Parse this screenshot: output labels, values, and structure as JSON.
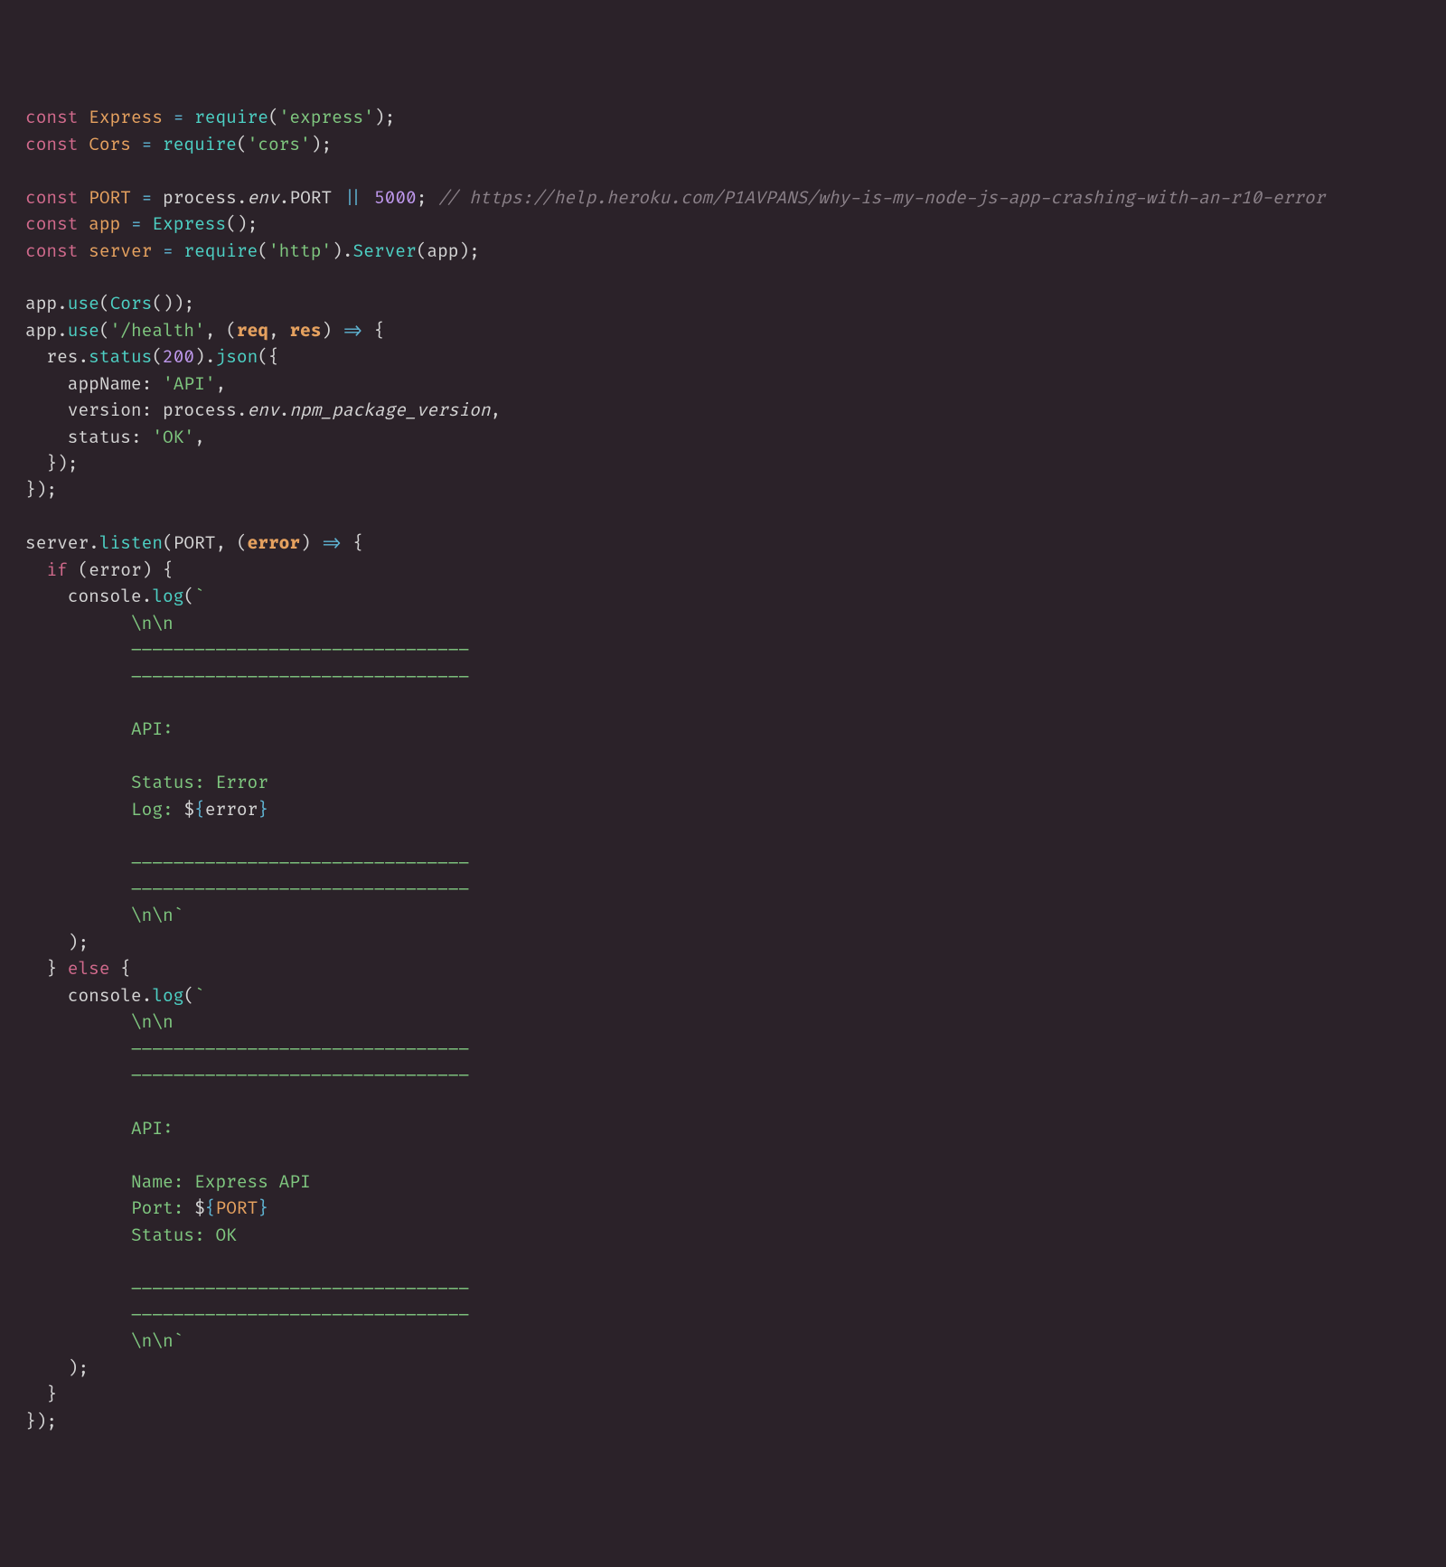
{
  "code": {
    "l1": {
      "kw": "const",
      "name": "Express",
      "eq": " = ",
      "fn": "require",
      "op1": "(",
      "str": "'express'",
      "op2": ")",
      "end": ";"
    },
    "l2": {
      "kw": "const",
      "name": "Cors",
      "eq": " = ",
      "fn": "require",
      "op1": "(",
      "str": "'cors'",
      "op2": ")",
      "end": ";"
    },
    "l4": {
      "kw": "const",
      "name": "PORT",
      "eq": " = ",
      "obj": "process",
      "dot1": ".",
      "env": "env",
      "dot2": ".",
      "prop": "PORT",
      "or": " || ",
      "num": "5000",
      "end": ";",
      "sp": " ",
      "comment": "// https://help.heroku.com/P1AVPANS/why-is-my-node-js-app-crashing-with-an-r10-error"
    },
    "l5": {
      "kw": "const",
      "name": "app",
      "eq": " = ",
      "fn": "Express",
      "paren": "()",
      "end": ";"
    },
    "l6": {
      "kw": "const",
      "name": "server",
      "eq": " = ",
      "fn1": "require",
      "op1": "(",
      "str": "'http'",
      "op2": ")",
      "dot": ".",
      "fn2": "Server",
      "op3": "(",
      "arg": "app",
      "op4": ")",
      "end": ";"
    },
    "l8": {
      "obj": "app",
      "dot": ".",
      "fn": "use",
      "op1": "(",
      "fn2": "Cors",
      "paren": "()",
      "op2": ")",
      "end": ";"
    },
    "l9": {
      "obj": "app",
      "dot": ".",
      "fn": "use",
      "op1": "(",
      "str": "'/health'",
      "comma": ", ",
      "op2": "(",
      "p1": "req",
      "c2": ", ",
      "p2": "res",
      "op3": ")",
      "arrow": " => ",
      "brace": "{"
    },
    "l10": {
      "indent": "  ",
      "obj": "res",
      "dot1": ".",
      "fn1": "status",
      "op1": "(",
      "num": "200",
      "op2": ")",
      "dot2": ".",
      "fn2": "json",
      "op3": "(",
      "brace": "{"
    },
    "l11": {
      "indent": "    ",
      "key": "appName",
      "colon": ": ",
      "str": "'API'",
      "comma": ","
    },
    "l12": {
      "indent": "    ",
      "key": "version",
      "colon": ": ",
      "obj": "process",
      "dot1": ".",
      "env": "env",
      "dot2": ".",
      "prop": "npm_package_version",
      "comma": ","
    },
    "l13": {
      "indent": "    ",
      "key": "status",
      "colon": ": ",
      "str": "'OK'",
      "comma": ","
    },
    "l14": {
      "indent": "  ",
      "close": "});"
    },
    "l15": {
      "close": "});"
    },
    "l17": {
      "obj": "server",
      "dot": ".",
      "fn": "listen",
      "op1": "(",
      "arg1": "PORT",
      "comma": ", ",
      "op2": "(",
      "p1": "error",
      "op3": ")",
      "arrow": " => ",
      "brace": "{"
    },
    "l18": {
      "indent": "  ",
      "kw": "if",
      "sp": " ",
      "op1": "(",
      "cond": "error",
      "op2": ")",
      "sp2": " ",
      "brace": "{"
    },
    "l19": {
      "indent": "    ",
      "obj": "console",
      "dot": ".",
      "fn": "log",
      "op1": "(",
      "tick": "`"
    },
    "l20": {
      "indent": "          ",
      "txt": "\\n\\n"
    },
    "l21": {
      "indent": "          ",
      "txt": "––––––––––––––––––––––––––––––––"
    },
    "l22": {
      "indent": "          ",
      "txt": "––––––––––––––––––––––––––––––––"
    },
    "l23": {
      "indent": "          ",
      "txt": ""
    },
    "l24": {
      "indent": "          ",
      "txt": "API:"
    },
    "l25": {
      "indent": "          ",
      "txt": ""
    },
    "l26": {
      "indent": "          ",
      "txt": "Status: Error"
    },
    "l27": {
      "indent": "          ",
      "txt1": "Log: ",
      "dollar": "$",
      "ob": "{",
      "var": "error",
      "cb": "}"
    },
    "l28": {
      "indent": "          ",
      "txt": ""
    },
    "l29": {
      "indent": "          ",
      "txt": "––––––––––––––––––––––––––––––––"
    },
    "l30": {
      "indent": "          ",
      "txt": "––––––––––––––––––––––––––––––––"
    },
    "l31": {
      "indent": "          ",
      "txt": "\\n\\n",
      "tick": "`"
    },
    "l32": {
      "indent": "    ",
      "close": ");"
    },
    "l33": {
      "indent": "  ",
      "close": "}",
      "sp": " ",
      "kw": "else",
      "sp2": " ",
      "brace": "{"
    },
    "l34": {
      "indent": "    ",
      "obj": "console",
      "dot": ".",
      "fn": "log",
      "op1": "(",
      "tick": "`"
    },
    "l35": {
      "indent": "          ",
      "txt": "\\n\\n"
    },
    "l36": {
      "indent": "          ",
      "txt": "––––––––––––––––––––––––––––––––"
    },
    "l37": {
      "indent": "          ",
      "txt": "––––––––––––––––––––––––––––––––"
    },
    "l38": {
      "indent": "          ",
      "txt": ""
    },
    "l39": {
      "indent": "          ",
      "txt": "API:"
    },
    "l40": {
      "indent": "          ",
      "txt": ""
    },
    "l41": {
      "indent": "          ",
      "txt": "Name: Express API"
    },
    "l42": {
      "indent": "          ",
      "txt1": "Port: ",
      "dollar": "$",
      "ob": "{",
      "var": "PORT",
      "cb": "}"
    },
    "l43": {
      "indent": "          ",
      "txt": "Status: OK"
    },
    "l44": {
      "indent": "          ",
      "txt": ""
    },
    "l45": {
      "indent": "          ",
      "txt": "––––––––––––––––––––––––––––––––"
    },
    "l46": {
      "indent": "          ",
      "txt": "––––––––––––––––––––––––––––––––"
    },
    "l47": {
      "indent": "          ",
      "txt": "\\n\\n",
      "tick": "`"
    },
    "l48": {
      "indent": "    ",
      "close": ");"
    },
    "l49": {
      "indent": "  ",
      "close": "}"
    },
    "l50": {
      "close": "});"
    }
  }
}
